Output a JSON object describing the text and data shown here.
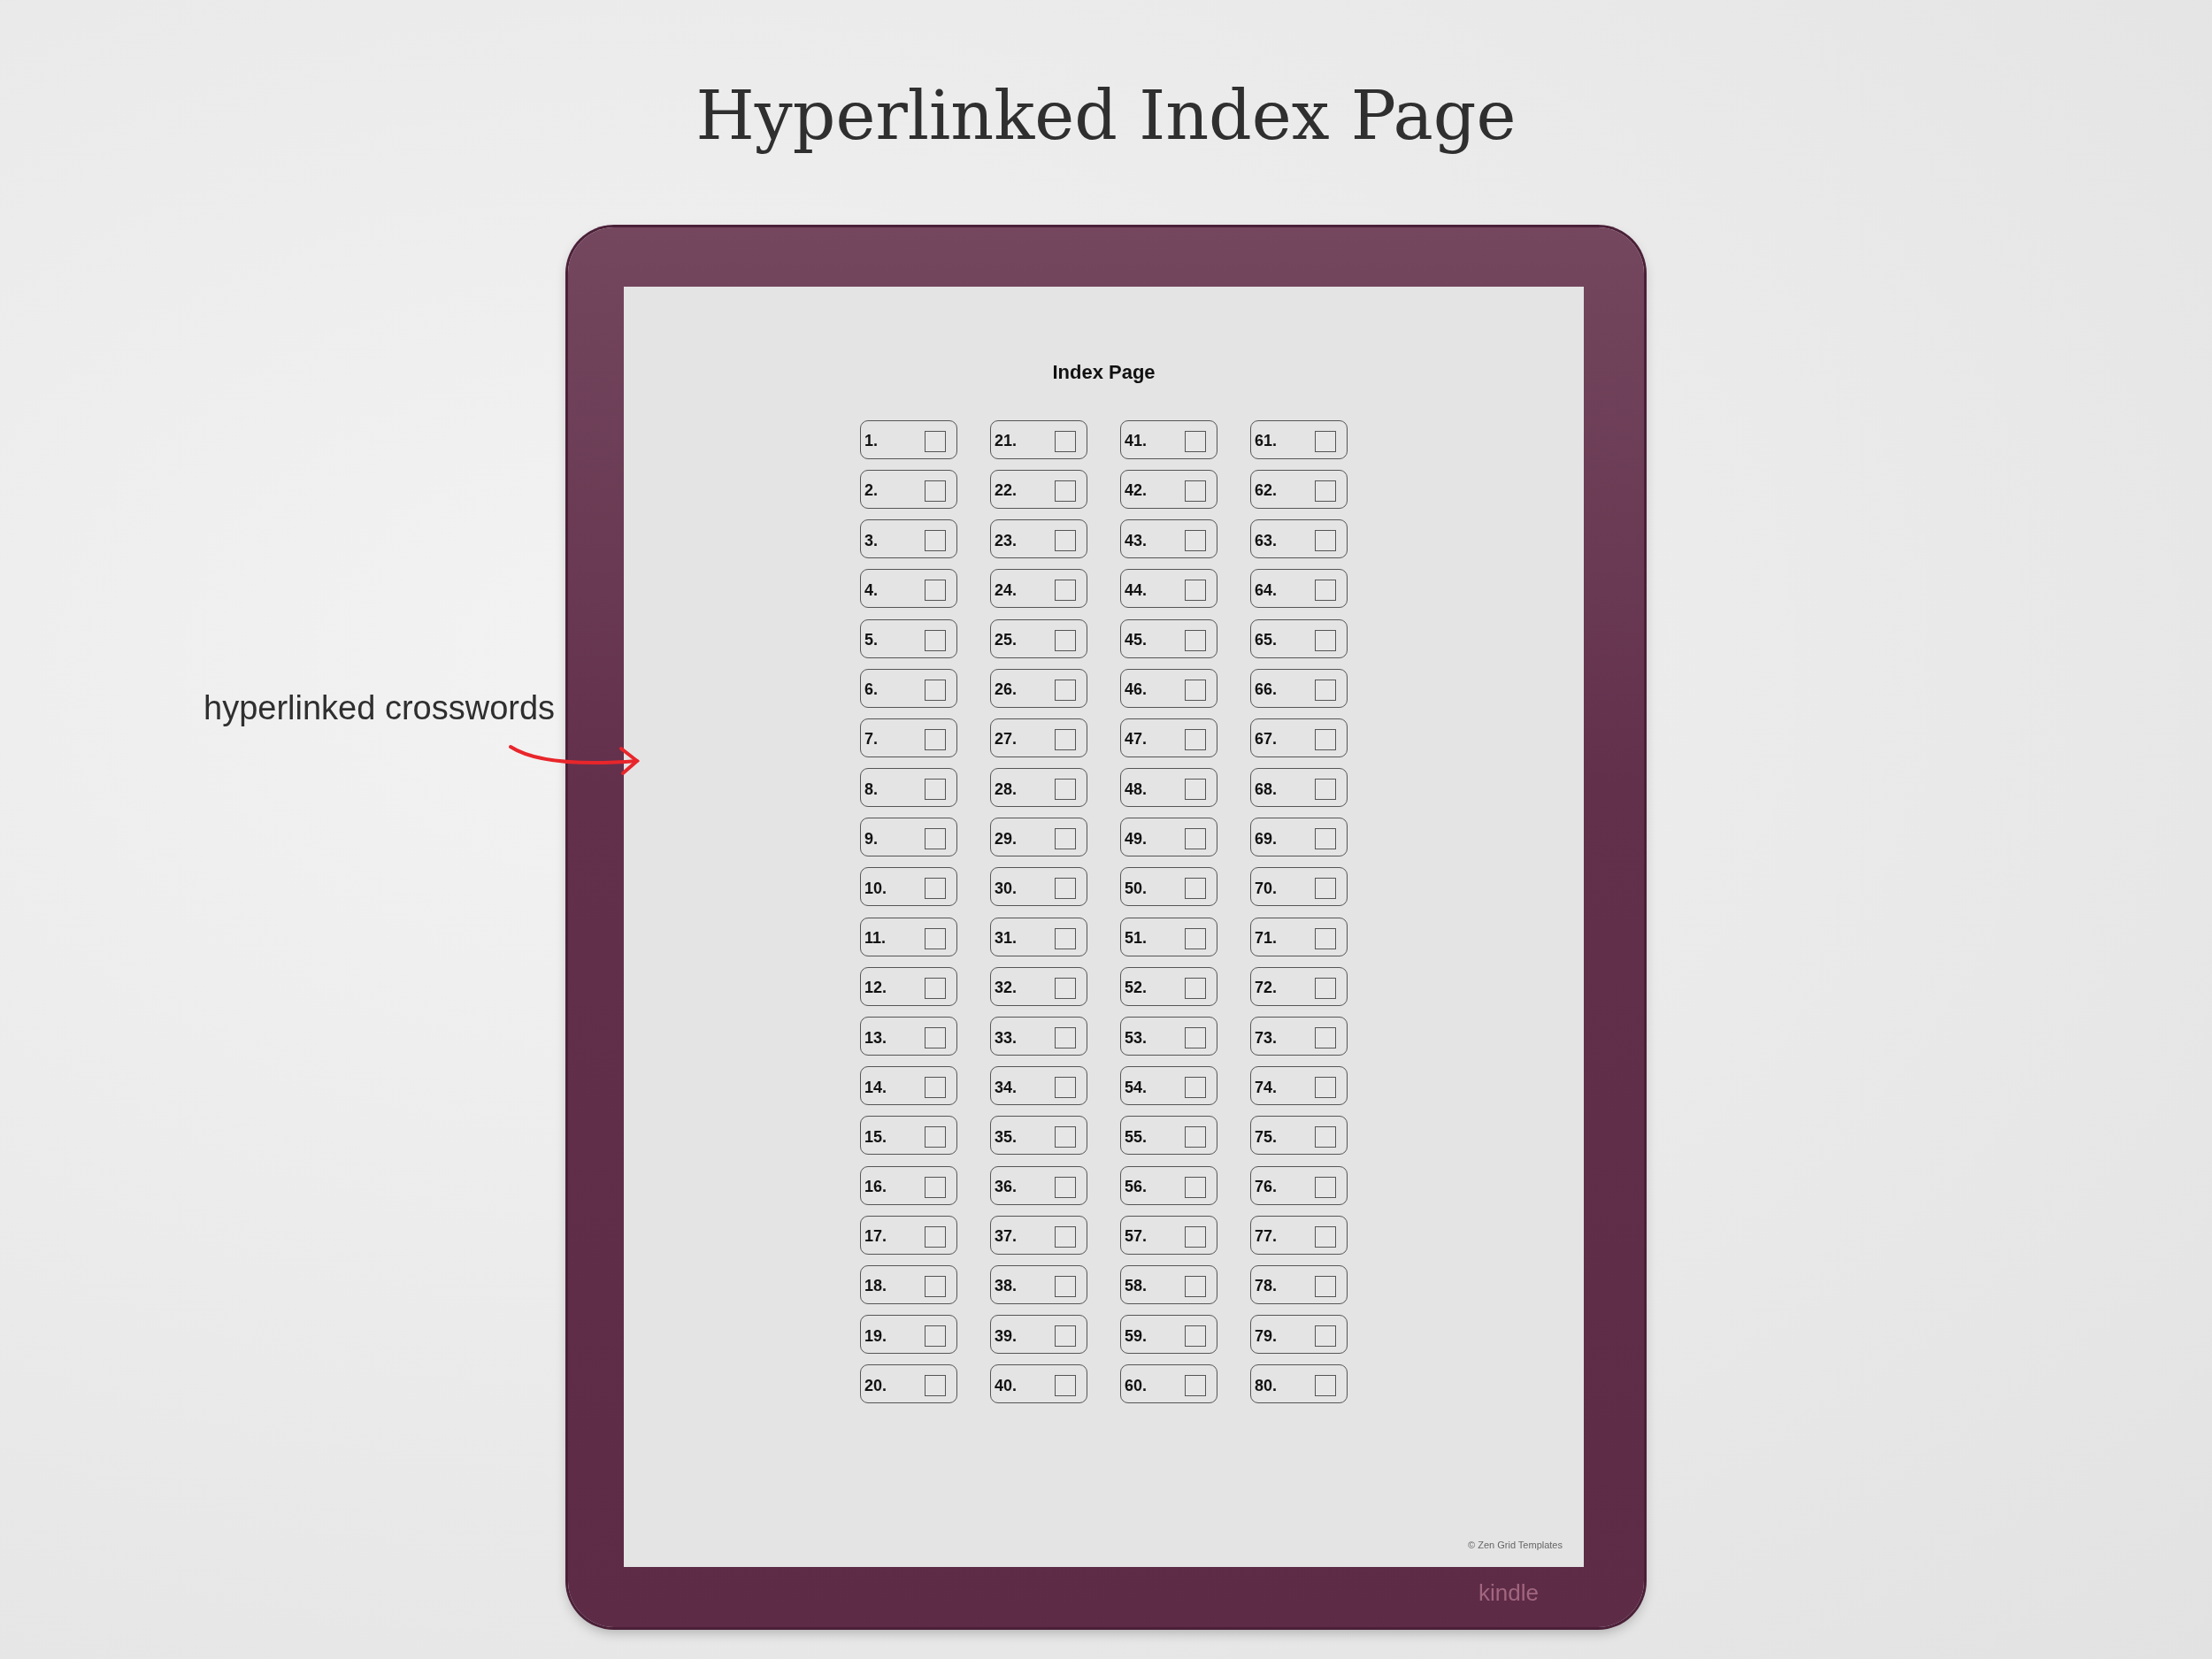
{
  "heading": "Hyperlinked Index Page",
  "annotation": {
    "text": "hyperlinked crosswords"
  },
  "device": {
    "brand": "kindle",
    "screen": {
      "title": "Index Page",
      "entries": [
        {
          "label": "1.",
          "checked": false
        },
        {
          "label": "2.",
          "checked": false
        },
        {
          "label": "3.",
          "checked": false
        },
        {
          "label": "4.",
          "checked": false
        },
        {
          "label": "5.",
          "checked": false
        },
        {
          "label": "6.",
          "checked": false
        },
        {
          "label": "7.",
          "checked": false
        },
        {
          "label": "8.",
          "checked": false
        },
        {
          "label": "9.",
          "checked": false
        },
        {
          "label": "10.",
          "checked": false
        },
        {
          "label": "11.",
          "checked": false
        },
        {
          "label": "12.",
          "checked": false
        },
        {
          "label": "13.",
          "checked": false
        },
        {
          "label": "14.",
          "checked": false
        },
        {
          "label": "15.",
          "checked": false
        },
        {
          "label": "16.",
          "checked": false
        },
        {
          "label": "17.",
          "checked": false
        },
        {
          "label": "18.",
          "checked": false
        },
        {
          "label": "19.",
          "checked": false
        },
        {
          "label": "20.",
          "checked": false
        },
        {
          "label": "21.",
          "checked": false
        },
        {
          "label": "22.",
          "checked": false
        },
        {
          "label": "23.",
          "checked": false
        },
        {
          "label": "24.",
          "checked": false
        },
        {
          "label": "25.",
          "checked": false
        },
        {
          "label": "26.",
          "checked": false
        },
        {
          "label": "27.",
          "checked": false
        },
        {
          "label": "28.",
          "checked": false
        },
        {
          "label": "29.",
          "checked": false
        },
        {
          "label": "30.",
          "checked": false
        },
        {
          "label": "31.",
          "checked": false
        },
        {
          "label": "32.",
          "checked": false
        },
        {
          "label": "33.",
          "checked": false
        },
        {
          "label": "34.",
          "checked": false
        },
        {
          "label": "35.",
          "checked": false
        },
        {
          "label": "36.",
          "checked": false
        },
        {
          "label": "37.",
          "checked": false
        },
        {
          "label": "38.",
          "checked": false
        },
        {
          "label": "39.",
          "checked": false
        },
        {
          "label": "40.",
          "checked": false
        },
        {
          "label": "41.",
          "checked": false
        },
        {
          "label": "42.",
          "checked": false
        },
        {
          "label": "43.",
          "checked": false
        },
        {
          "label": "44.",
          "checked": false
        },
        {
          "label": "45.",
          "checked": false
        },
        {
          "label": "46.",
          "checked": false
        },
        {
          "label": "47.",
          "checked": false
        },
        {
          "label": "48.",
          "checked": false
        },
        {
          "label": "49.",
          "checked": false
        },
        {
          "label": "50.",
          "checked": false
        },
        {
          "label": "51.",
          "checked": false
        },
        {
          "label": "52.",
          "checked": false
        },
        {
          "label": "53.",
          "checked": false
        },
        {
          "label": "54.",
          "checked": false
        },
        {
          "label": "55.",
          "checked": false
        },
        {
          "label": "56.",
          "checked": false
        },
        {
          "label": "57.",
          "checked": false
        },
        {
          "label": "58.",
          "checked": false
        },
        {
          "label": "59.",
          "checked": false
        },
        {
          "label": "60.",
          "checked": false
        },
        {
          "label": "61.",
          "checked": false
        },
        {
          "label": "62.",
          "checked": false
        },
        {
          "label": "63.",
          "checked": false
        },
        {
          "label": "64.",
          "checked": false
        },
        {
          "label": "65.",
          "checked": false
        },
        {
          "label": "66.",
          "checked": false
        },
        {
          "label": "67.",
          "checked": false
        },
        {
          "label": "68.",
          "checked": false
        },
        {
          "label": "69.",
          "checked": false
        },
        {
          "label": "70.",
          "checked": false
        },
        {
          "label": "71.",
          "checked": false
        },
        {
          "label": "72.",
          "checked": false
        },
        {
          "label": "73.",
          "checked": false
        },
        {
          "label": "74.",
          "checked": false
        },
        {
          "label": "75.",
          "checked": false
        },
        {
          "label": "76.",
          "checked": false
        },
        {
          "label": "77.",
          "checked": false
        },
        {
          "label": "78.",
          "checked": false
        },
        {
          "label": "79.",
          "checked": false
        },
        {
          "label": "80.",
          "checked": false
        }
      ],
      "footer": "© Zen Grid Templates"
    }
  }
}
